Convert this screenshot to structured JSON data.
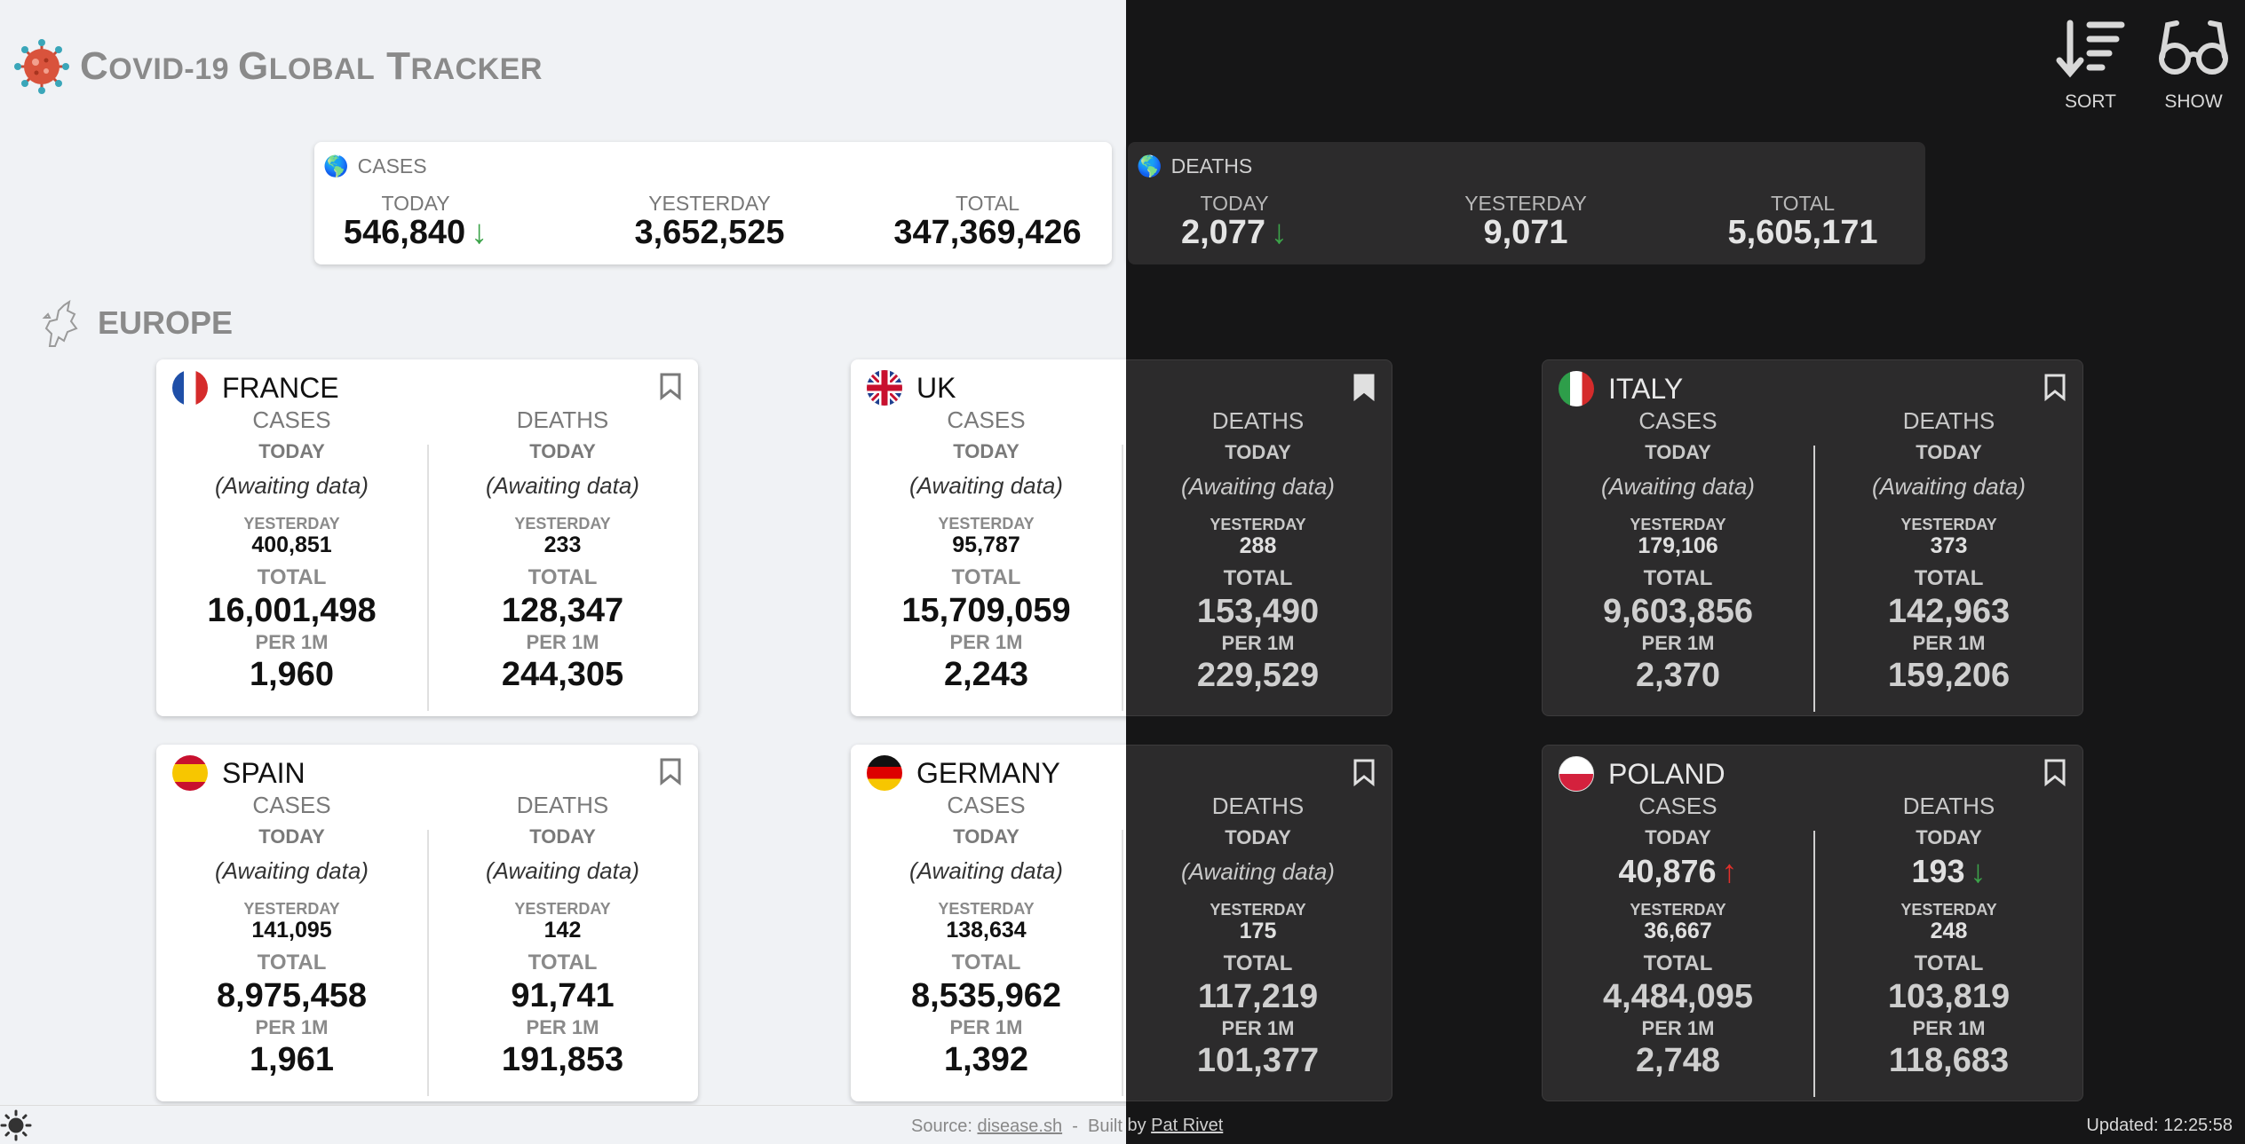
{
  "app": {
    "title_big1": "C",
    "title_small1": "OVID",
    "title_rest": "-19 ",
    "title_big2": "G",
    "title_small2": "LOBAL",
    "title_space": " ",
    "title_big3": "T",
    "title_small3": "RACKER"
  },
  "toolbar": {
    "sort_label": "SORT",
    "show_label": "SHOW"
  },
  "global": {
    "cases": {
      "label": "CASES",
      "today_label": "TODAY",
      "today": "546,840",
      "today_trend": "↓",
      "yesterday_label": "YESTERDAY",
      "yesterday": "3,652,525",
      "total_label": "TOTAL",
      "total": "347,369,426"
    },
    "deaths": {
      "label": "DEATHS",
      "today_label": "TODAY",
      "today": "2,077",
      "today_trend": "↓",
      "yesterday_label": "YESTERDAY",
      "yesterday": "9,071",
      "total_label": "TOTAL",
      "total": "5,605,171"
    }
  },
  "region": {
    "name": "EUROPE"
  },
  "labels": {
    "cases": "CASES",
    "deaths": "DEATHS",
    "today": "TODAY",
    "yesterday": "YESTERDAY",
    "total": "TOTAL",
    "per1m": "PER 1M"
  },
  "countries": [
    {
      "name": "FRANCE",
      "cases": {
        "today": "(Awaiting data)",
        "yesterday": "400,851",
        "total": "16,001,498",
        "per1m": "1,960"
      },
      "deaths": {
        "today": "(Awaiting data)",
        "yesterday": "233",
        "total": "128,347",
        "per1m": "244,305"
      }
    },
    {
      "name": "UK",
      "cases": {
        "today": "(Awaiting data)",
        "yesterday": "95,787",
        "total": "15,709,059",
        "per1m": "2,243"
      },
      "deaths": {
        "today": "(Awaiting data)",
        "yesterday": "288",
        "total": "153,490",
        "per1m": "229,529"
      }
    },
    {
      "name": "ITALY",
      "cases": {
        "today": "(Awaiting data)",
        "yesterday": "179,106",
        "total": "9,603,856",
        "per1m": "2,370"
      },
      "deaths": {
        "today": "(Awaiting data)",
        "yesterday": "373",
        "total": "142,963",
        "per1m": "159,206"
      }
    },
    {
      "name": "SPAIN",
      "cases": {
        "today": "(Awaiting data)",
        "yesterday": "141,095",
        "total": "8,975,458",
        "per1m": "1,961"
      },
      "deaths": {
        "today": "(Awaiting data)",
        "yesterday": "142",
        "total": "91,741",
        "per1m": "191,853"
      }
    },
    {
      "name": "GERMANY",
      "cases": {
        "today": "(Awaiting data)",
        "yesterday": "138,634",
        "total": "8,535,962",
        "per1m": "1,392"
      },
      "deaths": {
        "today": "(Awaiting data)",
        "yesterday": "175",
        "total": "117,219",
        "per1m": "101,377"
      }
    },
    {
      "name": "POLAND",
      "cases": {
        "today": "40,876",
        "today_trend": "↑",
        "yesterday": "36,667",
        "total": "4,484,095",
        "per1m": "2,748"
      },
      "deaths": {
        "today": "193",
        "today_trend": "↓",
        "yesterday": "248",
        "total": "103,819",
        "per1m": "118,683"
      }
    }
  ],
  "footer": {
    "source_prefix": "Source: ",
    "source_link": "disease.sh",
    "sep": "  -  Built by ",
    "author_link": "Pat Rivet",
    "updated": "Updated: 12:25:58"
  },
  "colors": {
    "trend_down": "#3ca34a",
    "trend_up": "#e0302b",
    "light_bg": "#f0f2f5",
    "dark_bg": "#161617",
    "dark_card": "#2c2b2c"
  },
  "icons": {
    "logo": "virus-icon",
    "sort": "sort-descending-icon",
    "show": "glasses-icon",
    "region": "europe-map-icon",
    "globe": "globe-icon",
    "bookmark": "bookmark-icon",
    "theme": "sun-icon"
  }
}
